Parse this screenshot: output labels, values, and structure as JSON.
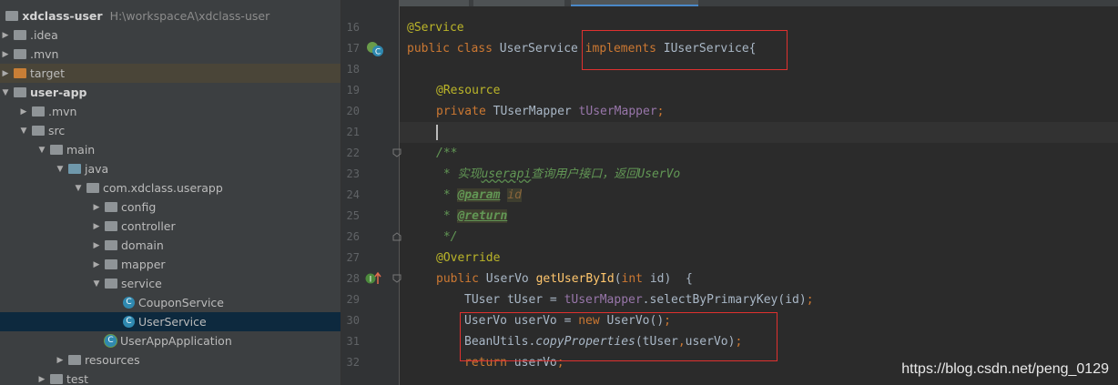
{
  "project_tree": {
    "root": {
      "name": "xdclass-user",
      "path": "H:\\workspaceA\\xdclass-user"
    },
    "items": [
      {
        "label": ".idea"
      },
      {
        "label": ".mvn"
      },
      {
        "label": "target"
      },
      {
        "label": "user-app"
      },
      {
        "label": ".mvn"
      },
      {
        "label": "src"
      },
      {
        "label": "main"
      },
      {
        "label": "java"
      },
      {
        "label": "com.xdclass.userapp"
      },
      {
        "label": "config"
      },
      {
        "label": "controller"
      },
      {
        "label": "domain"
      },
      {
        "label": "mapper"
      },
      {
        "label": "service"
      },
      {
        "label": "CouponService"
      },
      {
        "label": "UserService"
      },
      {
        "label": "UserAppApplication"
      },
      {
        "label": "resources"
      },
      {
        "label": "test"
      }
    ]
  },
  "editor": {
    "line_numbers": [
      "16",
      "17",
      "18",
      "19",
      "20",
      "21",
      "22",
      "23",
      "24",
      "25",
      "26",
      "27",
      "28",
      "29",
      "30",
      "31",
      "32"
    ],
    "lines": {
      "l16": {
        "ann": "@Service"
      },
      "l17": {
        "kw1": "public class ",
        "name": "UserService ",
        "kw2": "implements ",
        "iface": "IUserService{"
      },
      "l19": {
        "ann": "@Resource"
      },
      "l20": {
        "kw": "private ",
        "type": "TUserMapper ",
        "field": "tUserMapper",
        "semi": ";"
      },
      "l22": {
        "text": "/**"
      },
      "l23": {
        "prefix": " * 实现",
        "link": "userapi",
        "mid": "查询用户接口，返回",
        "ref": "UserVo"
      },
      "l24": {
        "prefix": " * ",
        "tag": "@param",
        "space": " ",
        "arg": "id"
      },
      "l25": {
        "prefix": " * ",
        "tag": "@return"
      },
      "l26": {
        "text": " */"
      },
      "l27": {
        "ann": "@Override"
      },
      "l28": {
        "kw": "public ",
        "type": "UserVo ",
        "fn": "getUserById",
        "open": "(",
        "kw2": "int ",
        "rest": "id)  {"
      },
      "l29": {
        "t1": "TUser tUser = ",
        "field": "tUserMapper",
        "t2": ".selectByPrimaryKey(id)",
        "semi": ";"
      },
      "l30": {
        "t1": "UserVo userVo = ",
        "kw": "new ",
        "t2": "UserVo()",
        "semi": ";"
      },
      "l31": {
        "t1": "BeanUtils.",
        "m": "copyProperties",
        "t2": "(tUser",
        "comma": ",",
        "t3": "userVo)",
        "semi": ";"
      },
      "l32": {
        "kw": "return ",
        "t1": "userVo",
        "semi": ";"
      }
    }
  },
  "watermark": "https://blog.csdn.net/peng_0129",
  "colors": {
    "keyword": "#cc7832",
    "annotation": "#bbb529",
    "field": "#9876aa",
    "doc": "#629755",
    "method": "#ffc66d",
    "highlight_box": "#e0312f"
  }
}
